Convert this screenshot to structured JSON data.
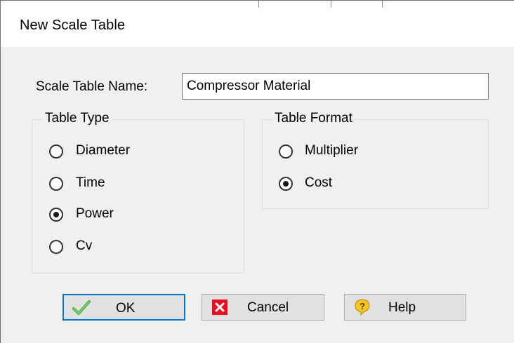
{
  "window": {
    "title": "New Scale Table"
  },
  "name": {
    "label": "Scale Table Name:",
    "value": "Compressor Material"
  },
  "table_type": {
    "legend": "Table Type",
    "options": [
      {
        "label": "Diameter",
        "checked": false
      },
      {
        "label": "Time",
        "checked": false
      },
      {
        "label": "Power",
        "checked": true
      },
      {
        "label": "Cv",
        "checked": false
      }
    ]
  },
  "table_format": {
    "legend": "Table Format",
    "options": [
      {
        "label": "Multiplier",
        "checked": false
      },
      {
        "label": "Cost",
        "checked": true
      }
    ]
  },
  "buttons": {
    "ok": {
      "label": "OK",
      "icon": "check-icon",
      "color": "#3cb043"
    },
    "cancel": {
      "label": "Cancel",
      "icon": "close-icon",
      "color": "#e81123"
    },
    "help": {
      "label": "Help",
      "icon": "help-icon",
      "color": "#e8b923"
    }
  }
}
